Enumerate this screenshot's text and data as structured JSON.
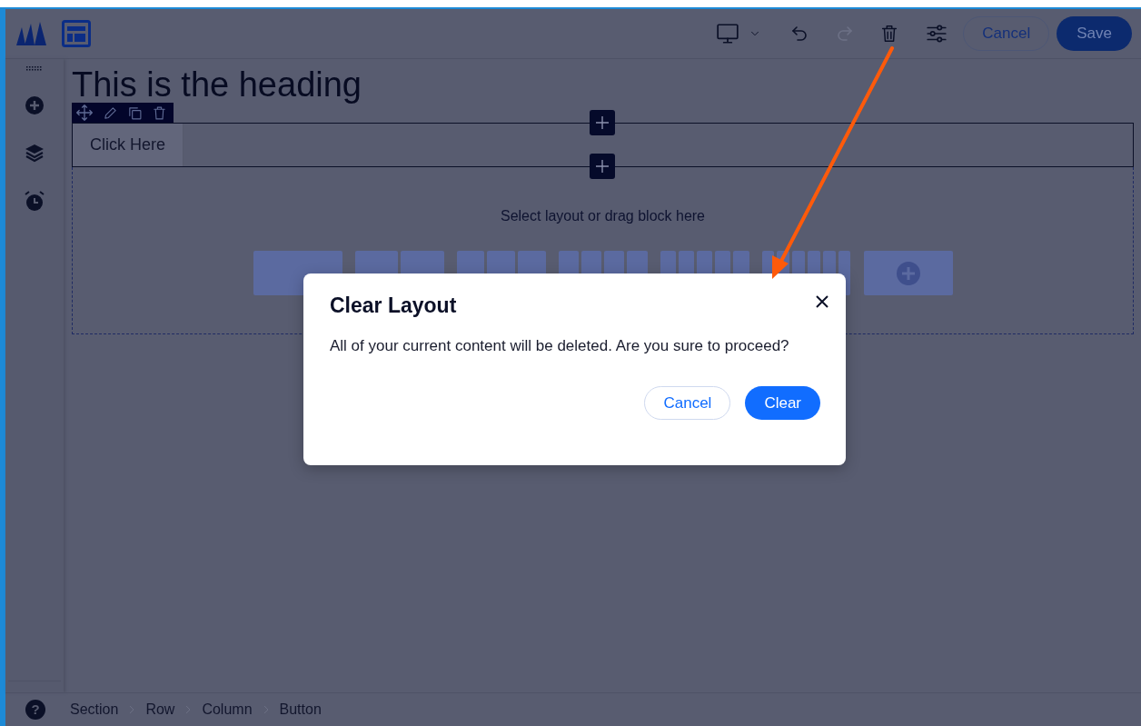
{
  "toolbar": {
    "redo_disabled": true,
    "cancel_label": "Cancel",
    "save_label": "Save"
  },
  "canvas": {
    "heading": "This is the heading",
    "button_label": "Click Here",
    "drop_hint": "Select layout or drag block here"
  },
  "sidebar": {
    "help_label": "?"
  },
  "breadcrumb": [
    "Section",
    "Row",
    "Column",
    "Button"
  ],
  "dialog": {
    "title": "Clear Layout",
    "message": "All of your current content will be deleted. Are you sure to proceed?",
    "cancel_label": "Cancel",
    "confirm_label": "Clear"
  }
}
